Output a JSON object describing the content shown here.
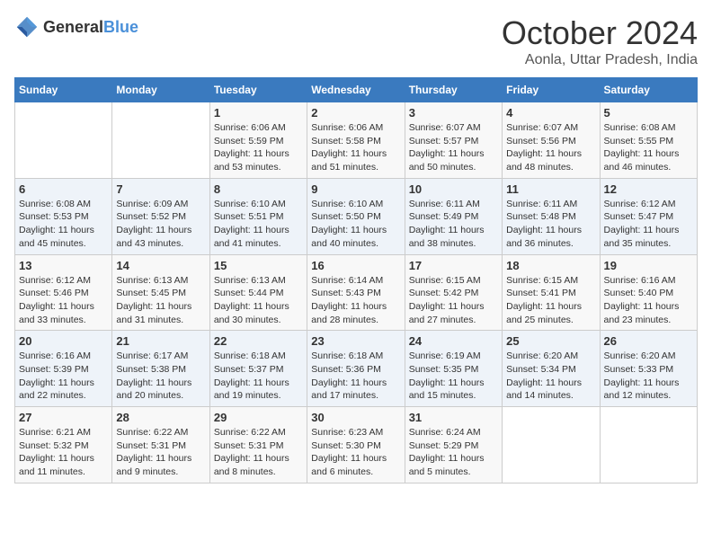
{
  "header": {
    "logo_general": "General",
    "logo_blue": "Blue",
    "month_title": "October 2024",
    "subtitle": "Aonla, Uttar Pradesh, India"
  },
  "weekdays": [
    "Sunday",
    "Monday",
    "Tuesday",
    "Wednesday",
    "Thursday",
    "Friday",
    "Saturday"
  ],
  "weeks": [
    [
      {
        "day": "",
        "sunrise": "",
        "sunset": "",
        "daylight": ""
      },
      {
        "day": "",
        "sunrise": "",
        "sunset": "",
        "daylight": ""
      },
      {
        "day": "1",
        "sunrise": "Sunrise: 6:06 AM",
        "sunset": "Sunset: 5:59 PM",
        "daylight": "Daylight: 11 hours and 53 minutes."
      },
      {
        "day": "2",
        "sunrise": "Sunrise: 6:06 AM",
        "sunset": "Sunset: 5:58 PM",
        "daylight": "Daylight: 11 hours and 51 minutes."
      },
      {
        "day": "3",
        "sunrise": "Sunrise: 6:07 AM",
        "sunset": "Sunset: 5:57 PM",
        "daylight": "Daylight: 11 hours and 50 minutes."
      },
      {
        "day": "4",
        "sunrise": "Sunrise: 6:07 AM",
        "sunset": "Sunset: 5:56 PM",
        "daylight": "Daylight: 11 hours and 48 minutes."
      },
      {
        "day": "5",
        "sunrise": "Sunrise: 6:08 AM",
        "sunset": "Sunset: 5:55 PM",
        "daylight": "Daylight: 11 hours and 46 minutes."
      }
    ],
    [
      {
        "day": "6",
        "sunrise": "Sunrise: 6:08 AM",
        "sunset": "Sunset: 5:53 PM",
        "daylight": "Daylight: 11 hours and 45 minutes."
      },
      {
        "day": "7",
        "sunrise": "Sunrise: 6:09 AM",
        "sunset": "Sunset: 5:52 PM",
        "daylight": "Daylight: 11 hours and 43 minutes."
      },
      {
        "day": "8",
        "sunrise": "Sunrise: 6:10 AM",
        "sunset": "Sunset: 5:51 PM",
        "daylight": "Daylight: 11 hours and 41 minutes."
      },
      {
        "day": "9",
        "sunrise": "Sunrise: 6:10 AM",
        "sunset": "Sunset: 5:50 PM",
        "daylight": "Daylight: 11 hours and 40 minutes."
      },
      {
        "day": "10",
        "sunrise": "Sunrise: 6:11 AM",
        "sunset": "Sunset: 5:49 PM",
        "daylight": "Daylight: 11 hours and 38 minutes."
      },
      {
        "day": "11",
        "sunrise": "Sunrise: 6:11 AM",
        "sunset": "Sunset: 5:48 PM",
        "daylight": "Daylight: 11 hours and 36 minutes."
      },
      {
        "day": "12",
        "sunrise": "Sunrise: 6:12 AM",
        "sunset": "Sunset: 5:47 PM",
        "daylight": "Daylight: 11 hours and 35 minutes."
      }
    ],
    [
      {
        "day": "13",
        "sunrise": "Sunrise: 6:12 AM",
        "sunset": "Sunset: 5:46 PM",
        "daylight": "Daylight: 11 hours and 33 minutes."
      },
      {
        "day": "14",
        "sunrise": "Sunrise: 6:13 AM",
        "sunset": "Sunset: 5:45 PM",
        "daylight": "Daylight: 11 hours and 31 minutes."
      },
      {
        "day": "15",
        "sunrise": "Sunrise: 6:13 AM",
        "sunset": "Sunset: 5:44 PM",
        "daylight": "Daylight: 11 hours and 30 minutes."
      },
      {
        "day": "16",
        "sunrise": "Sunrise: 6:14 AM",
        "sunset": "Sunset: 5:43 PM",
        "daylight": "Daylight: 11 hours and 28 minutes."
      },
      {
        "day": "17",
        "sunrise": "Sunrise: 6:15 AM",
        "sunset": "Sunset: 5:42 PM",
        "daylight": "Daylight: 11 hours and 27 minutes."
      },
      {
        "day": "18",
        "sunrise": "Sunrise: 6:15 AM",
        "sunset": "Sunset: 5:41 PM",
        "daylight": "Daylight: 11 hours and 25 minutes."
      },
      {
        "day": "19",
        "sunrise": "Sunrise: 6:16 AM",
        "sunset": "Sunset: 5:40 PM",
        "daylight": "Daylight: 11 hours and 23 minutes."
      }
    ],
    [
      {
        "day": "20",
        "sunrise": "Sunrise: 6:16 AM",
        "sunset": "Sunset: 5:39 PM",
        "daylight": "Daylight: 11 hours and 22 minutes."
      },
      {
        "day": "21",
        "sunrise": "Sunrise: 6:17 AM",
        "sunset": "Sunset: 5:38 PM",
        "daylight": "Daylight: 11 hours and 20 minutes."
      },
      {
        "day": "22",
        "sunrise": "Sunrise: 6:18 AM",
        "sunset": "Sunset: 5:37 PM",
        "daylight": "Daylight: 11 hours and 19 minutes."
      },
      {
        "day": "23",
        "sunrise": "Sunrise: 6:18 AM",
        "sunset": "Sunset: 5:36 PM",
        "daylight": "Daylight: 11 hours and 17 minutes."
      },
      {
        "day": "24",
        "sunrise": "Sunrise: 6:19 AM",
        "sunset": "Sunset: 5:35 PM",
        "daylight": "Daylight: 11 hours and 15 minutes."
      },
      {
        "day": "25",
        "sunrise": "Sunrise: 6:20 AM",
        "sunset": "Sunset: 5:34 PM",
        "daylight": "Daylight: 11 hours and 14 minutes."
      },
      {
        "day": "26",
        "sunrise": "Sunrise: 6:20 AM",
        "sunset": "Sunset: 5:33 PM",
        "daylight": "Daylight: 11 hours and 12 minutes."
      }
    ],
    [
      {
        "day": "27",
        "sunrise": "Sunrise: 6:21 AM",
        "sunset": "Sunset: 5:32 PM",
        "daylight": "Daylight: 11 hours and 11 minutes."
      },
      {
        "day": "28",
        "sunrise": "Sunrise: 6:22 AM",
        "sunset": "Sunset: 5:31 PM",
        "daylight": "Daylight: 11 hours and 9 minutes."
      },
      {
        "day": "29",
        "sunrise": "Sunrise: 6:22 AM",
        "sunset": "Sunset: 5:31 PM",
        "daylight": "Daylight: 11 hours and 8 minutes."
      },
      {
        "day": "30",
        "sunrise": "Sunrise: 6:23 AM",
        "sunset": "Sunset: 5:30 PM",
        "daylight": "Daylight: 11 hours and 6 minutes."
      },
      {
        "day": "31",
        "sunrise": "Sunrise: 6:24 AM",
        "sunset": "Sunset: 5:29 PM",
        "daylight": "Daylight: 11 hours and 5 minutes."
      },
      {
        "day": "",
        "sunrise": "",
        "sunset": "",
        "daylight": ""
      },
      {
        "day": "",
        "sunrise": "",
        "sunset": "",
        "daylight": ""
      }
    ]
  ]
}
